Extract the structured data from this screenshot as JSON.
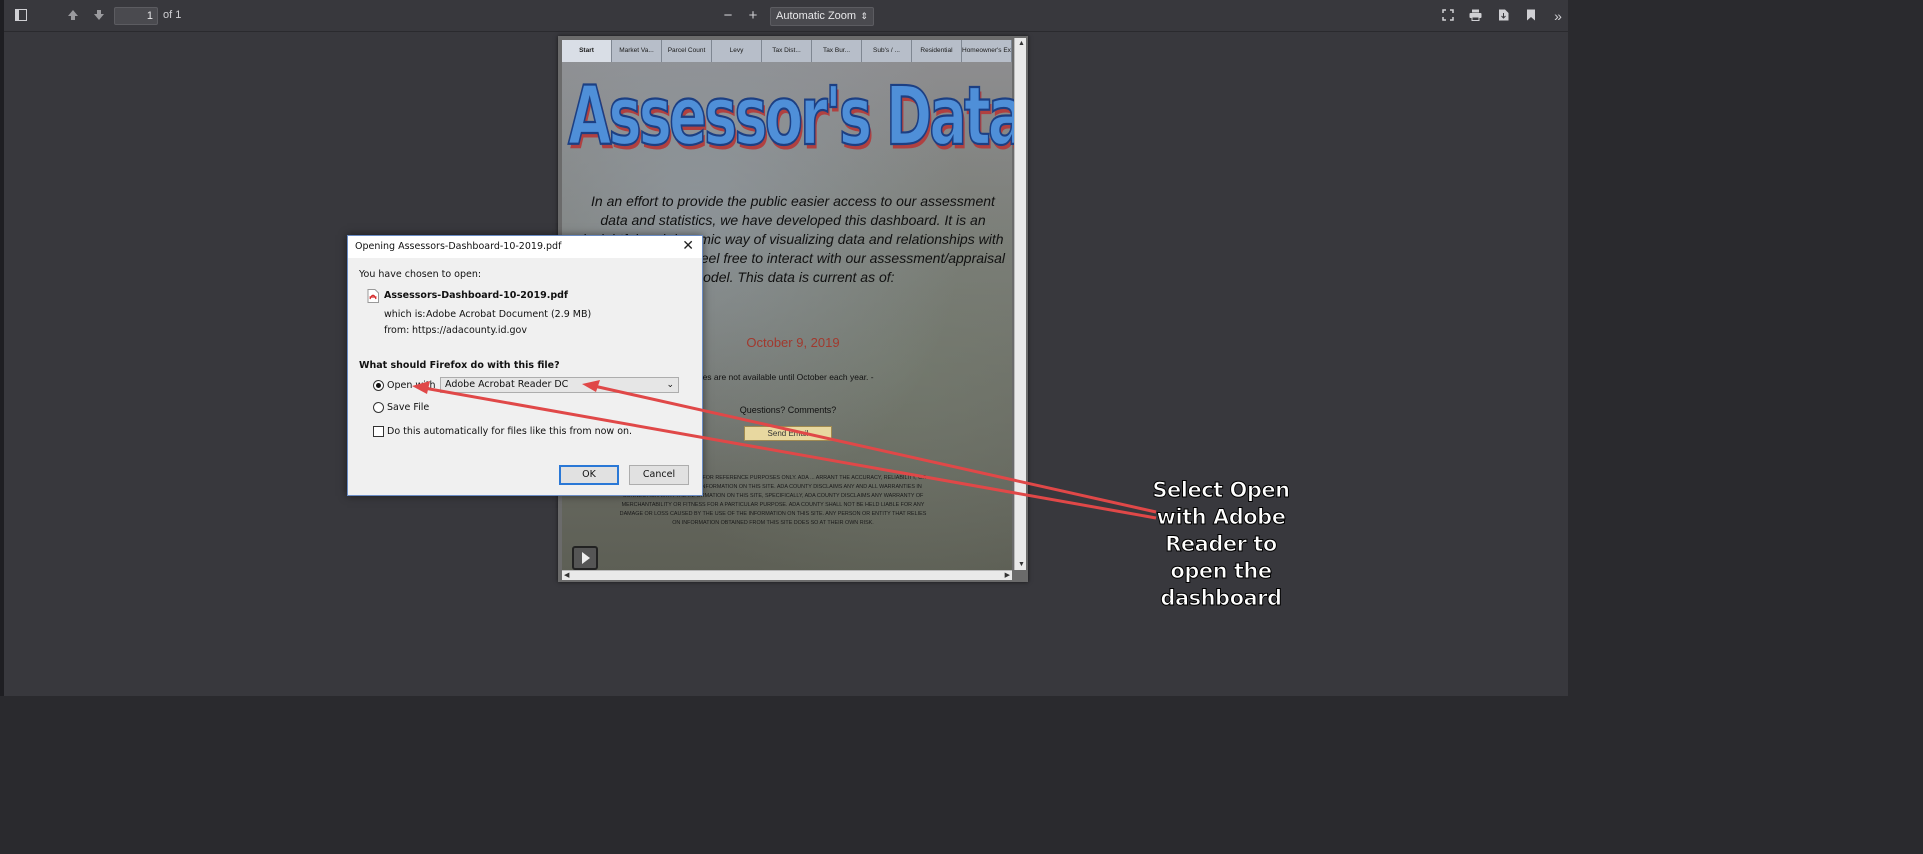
{
  "toolbar": {
    "page_number": "1",
    "page_count": "of 1",
    "zoom_minus": "−",
    "zoom_plus": "+",
    "zoom_value": "Automatic Zoom",
    "icons": [
      "sidebar-toggle-icon",
      "previous-page-icon",
      "next-page-icon",
      "presentation-mode-icon",
      "print-icon",
      "download-icon",
      "bookmark-icon",
      "tools-icon"
    ]
  },
  "pdf": {
    "tabs": [
      "Start",
      "Market Va...",
      "Parcel Count",
      "Levy",
      "Tax Dist...",
      "Tax Bur...",
      "Sub's / ...",
      "Residential",
      "Homeowner's Exem..."
    ],
    "title": "Assessor's Data Dashboard",
    "intro": "In an effort to provide the public easier access to our assessment data and statistics, we have developed this dashboard.  It is an insightful and dynamic way of visualizing data and relationships with click ease.  Please feel free to interact with our assessment/appraisal model.  This data is current as of:",
    "date": "October 9, 2019",
    "note": "ty values are not available until October each year. -",
    "questions": "Questions?  Comments?",
    "email_button": "Send Email",
    "disclaimer": "D ON THIS SITE IS TO BE USED FOR REFERENCE PURPOSES ONLY. ADA ... ARRANT THE ACCURACY, RELIABILITY, OR TIMELINESS OF ANY OF THE INFORMATION ON THIS SITE. ADA COUNTY DISCLAIMS ANY AND ALL WARRANTIES IN CONNECTION WITH THE INFORMATION ON THIS SITE, SPECIFICALLY, ADA COUNTY DISCLAIMS ANY WARRANTY OF MERCHANTABILITY OR FITNESS FOR A PARTICULAR PURPOSE. ADA COUNTY SHALL NOT BE HELD LIABLE FOR ANY DAMAGE OR LOSS CAUSED BY THE USE OF THE INFORMATION ON THIS SITE. ANY PERSON OR ENTITY THAT RELIES ON INFORMATION OBTAINED FROM THIS SITE DOES SO AT THEIR OWN RISK."
  },
  "dialog": {
    "title": "Opening Assessors-Dashboard-10-2019.pdf",
    "close": "✕",
    "chosen_label": "You have chosen to open:",
    "file_name": "Assessors-Dashboard-10-2019.pdf",
    "which_is_label": "which is:",
    "which_is_value": "Adobe Acrobat Document (2.9 MB)",
    "from_label": "from:",
    "from_value": "https://adacounty.id.gov",
    "question": "What should Firefox do with this file?",
    "open_with_label": "Open with",
    "open_with_app": "Adobe Acrobat Reader DC",
    "save_file_label": "Save File",
    "auto_label": "Do this automatically for files like this from now on.",
    "ok": "OK",
    "cancel": "Cancel",
    "open_with_selected": true,
    "auto_checked": false
  },
  "annotation": {
    "callout_lines": [
      "Select Open",
      "with Adobe",
      "Reader to",
      "open the",
      "dashboard"
    ],
    "arrow_color": "#e04848"
  }
}
